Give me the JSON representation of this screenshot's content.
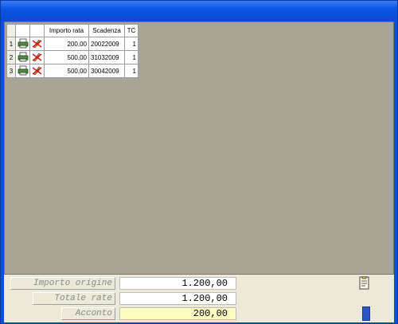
{
  "grid": {
    "columns": [
      "",
      "",
      "",
      "Importo rata",
      "Scadenza",
      "TC"
    ],
    "rows": [
      {
        "num": "1",
        "importo": "200,00",
        "scadenza": "20022009",
        "tc": "1"
      },
      {
        "num": "2",
        "importo": "500,00",
        "scadenza": "31032009",
        "tc": "1"
      },
      {
        "num": "3",
        "importo": "500,00",
        "scadenza": "30042009",
        "tc": "1"
      }
    ],
    "row_icons": [
      "printer-icon",
      "edit-icon"
    ]
  },
  "footer": {
    "importo_origine": {
      "label": "Importo origine",
      "value": "1.200,00"
    },
    "totale_rate": {
      "label": "Totale rate",
      "value": "1.200,00"
    },
    "acconto": {
      "label": "Acconto",
      "value": "200,00"
    }
  },
  "colors": {
    "titlebar": "#0a56e6",
    "client": "#a8a496",
    "highlight_field": "#fefdc0",
    "accent_bar": "#2a56c8"
  }
}
